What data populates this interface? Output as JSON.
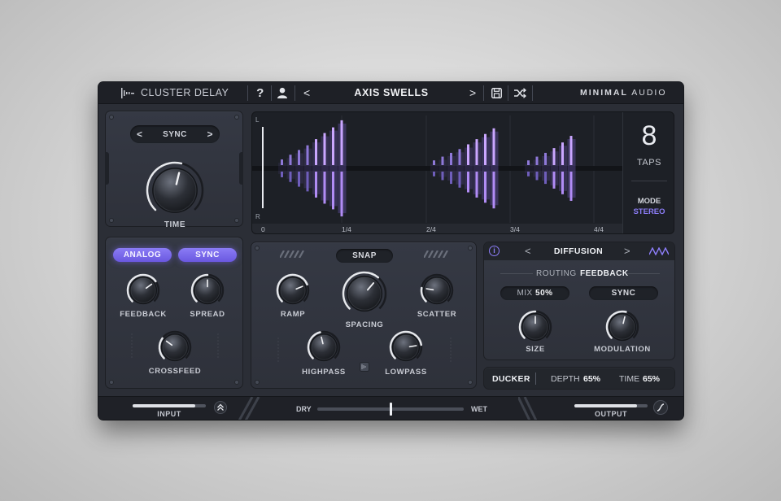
{
  "header": {
    "plugin_name": "CLUSTER DELAY",
    "help_label": "?",
    "preset_name": "AXIS SWELLS",
    "prev_label": "<",
    "next_label": ">",
    "brand_bold": "MINIMAL",
    "brand_light": " AUDIO"
  },
  "time_panel": {
    "mode_label": "SYNC",
    "prev": "<",
    "next": ">",
    "time_label": "TIME",
    "time_value": 0.55
  },
  "mod_panel": {
    "analog_label": "ANALOG",
    "sync_label": "SYNC",
    "feedback_label": "FEEDBACK",
    "feedback_value": 0.7,
    "spread_label": "SPREAD",
    "spread_value": 0.5,
    "crossfeed_label": "CROSSFEED",
    "crossfeed_value": 0.3
  },
  "display": {
    "channel_l": "L",
    "channel_r": "R",
    "markers": [
      "0",
      "1/4",
      "2/4",
      "3/4",
      "4/4"
    ],
    "taps_count": "8",
    "taps_label": "TAPS",
    "mode_label": "MODE",
    "mode_value": "STEREO",
    "bars": [
      0.12,
      0.22,
      0.32,
      0.42,
      0.55,
      0.68,
      0.8,
      0.95,
      0.1,
      0.18,
      0.26,
      0.34,
      0.44,
      0.55,
      0.66,
      0.78,
      0.1,
      0.18,
      0.26,
      0.36,
      0.48,
      0.62
    ]
  },
  "spacing_panel": {
    "snap_label": "SNAP",
    "ramp_label": "RAMP",
    "ramp_value": 0.75,
    "spacing_label": "SPACING",
    "spacing_value": 0.65,
    "scatter_label": "SCATTER",
    "scatter_value": 0.2,
    "highpass_label": "HIGHPASS",
    "highpass_value": 0.45,
    "lowpass_label": "LOWPASS",
    "lowpass_value": 0.8
  },
  "diffusion_panel": {
    "info_label": "i",
    "title": "DIFFUSION",
    "prev": "<",
    "next": ">",
    "routing_label": "ROUTING",
    "routing_value": "FEEDBACK",
    "mix_label": "MIX",
    "mix_value": "50%",
    "sync_label": "SYNC",
    "size_label": "SIZE",
    "size_value": 0.5,
    "modulation_label": "MODULATION",
    "modulation_value": 0.55
  },
  "ducker": {
    "label": "DUCKER",
    "depth_label": "DEPTH",
    "depth_value": "65%",
    "time_label": "TIME",
    "time_value": "65%"
  },
  "footer": {
    "input_label": "INPUT",
    "input_value": 0.85,
    "dry_label": "DRY",
    "wet_label": "WET",
    "mix_value": 0.5,
    "output_label": "OUTPUT",
    "output_value": 0.85
  },
  "colors": {
    "accent": "#8a78f4",
    "bar_light": "#c9a8ff",
    "bar_dark": "#6b5aa6",
    "panel": "#333640",
    "header": "#1e2026"
  }
}
